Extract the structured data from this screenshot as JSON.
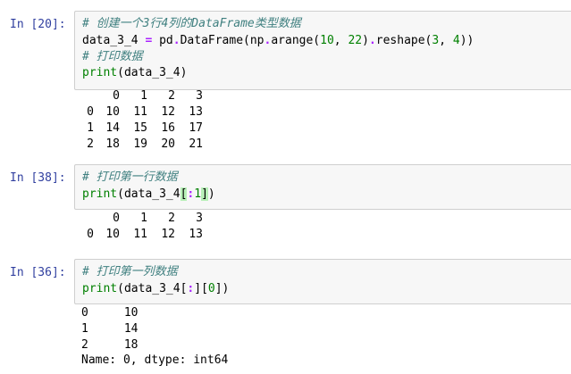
{
  "cells": [
    {
      "prompt": "In [20]:",
      "code": {
        "line1_comment": "# 创建一个3行4列的DataFrame类型数据",
        "line2_a": "data_3_4 ",
        "line2_eq": "=",
        "line2_b": " pd",
        "line2_c": ".",
        "line2_d": "DataFrame(np",
        "line2_e": ".",
        "line2_f": "arange(",
        "line2_n1": "10",
        "line2_g": ", ",
        "line2_n2": "22",
        "line2_h": ")",
        "line2_i": ".",
        "line2_j": "reshape(",
        "line2_n3": "3",
        "line2_k": ", ",
        "line2_n4": "4",
        "line2_l": "))",
        "line3_comment": "# 打印数据",
        "line4_kw": "print",
        "line4_rest": "(data_3_4)"
      },
      "output": {
        "columns": [
          "",
          "0",
          "1",
          "2",
          "3"
        ],
        "rows": [
          [
            "0",
            "10",
            "11",
            "12",
            "13"
          ],
          [
            "1",
            "14",
            "15",
            "16",
            "17"
          ],
          [
            "2",
            "18",
            "19",
            "20",
            "21"
          ]
        ]
      }
    },
    {
      "prompt": "In [38]:",
      "code": {
        "line1_comment": "# 打印第一行数据",
        "line2_kw": "print",
        "line2_a": "(data_3_4",
        "line2_b": "[",
        "line2_c": ":",
        "line2_n": "1",
        "line2_d": "]",
        "line2_e": ")"
      },
      "output": {
        "columns": [
          "",
          "0",
          "1",
          "2",
          "3"
        ],
        "rows": [
          [
            "0",
            "10",
            "11",
            "12",
            "13"
          ]
        ]
      }
    },
    {
      "prompt": "In [36]:",
      "code": {
        "line1_comment": "# 打印第一列数据",
        "line2_kw": "print",
        "line2_a": "(data_3_4[",
        "line2_b": ":",
        "line2_c": "][",
        "line2_n": "0",
        "line2_d": "])"
      },
      "output": {
        "series_rows": [
          [
            "0",
            "10"
          ],
          [
            "1",
            "14"
          ],
          [
            "2",
            "18"
          ]
        ],
        "footer": "Name: 0, dtype: int64"
      }
    }
  ]
}
